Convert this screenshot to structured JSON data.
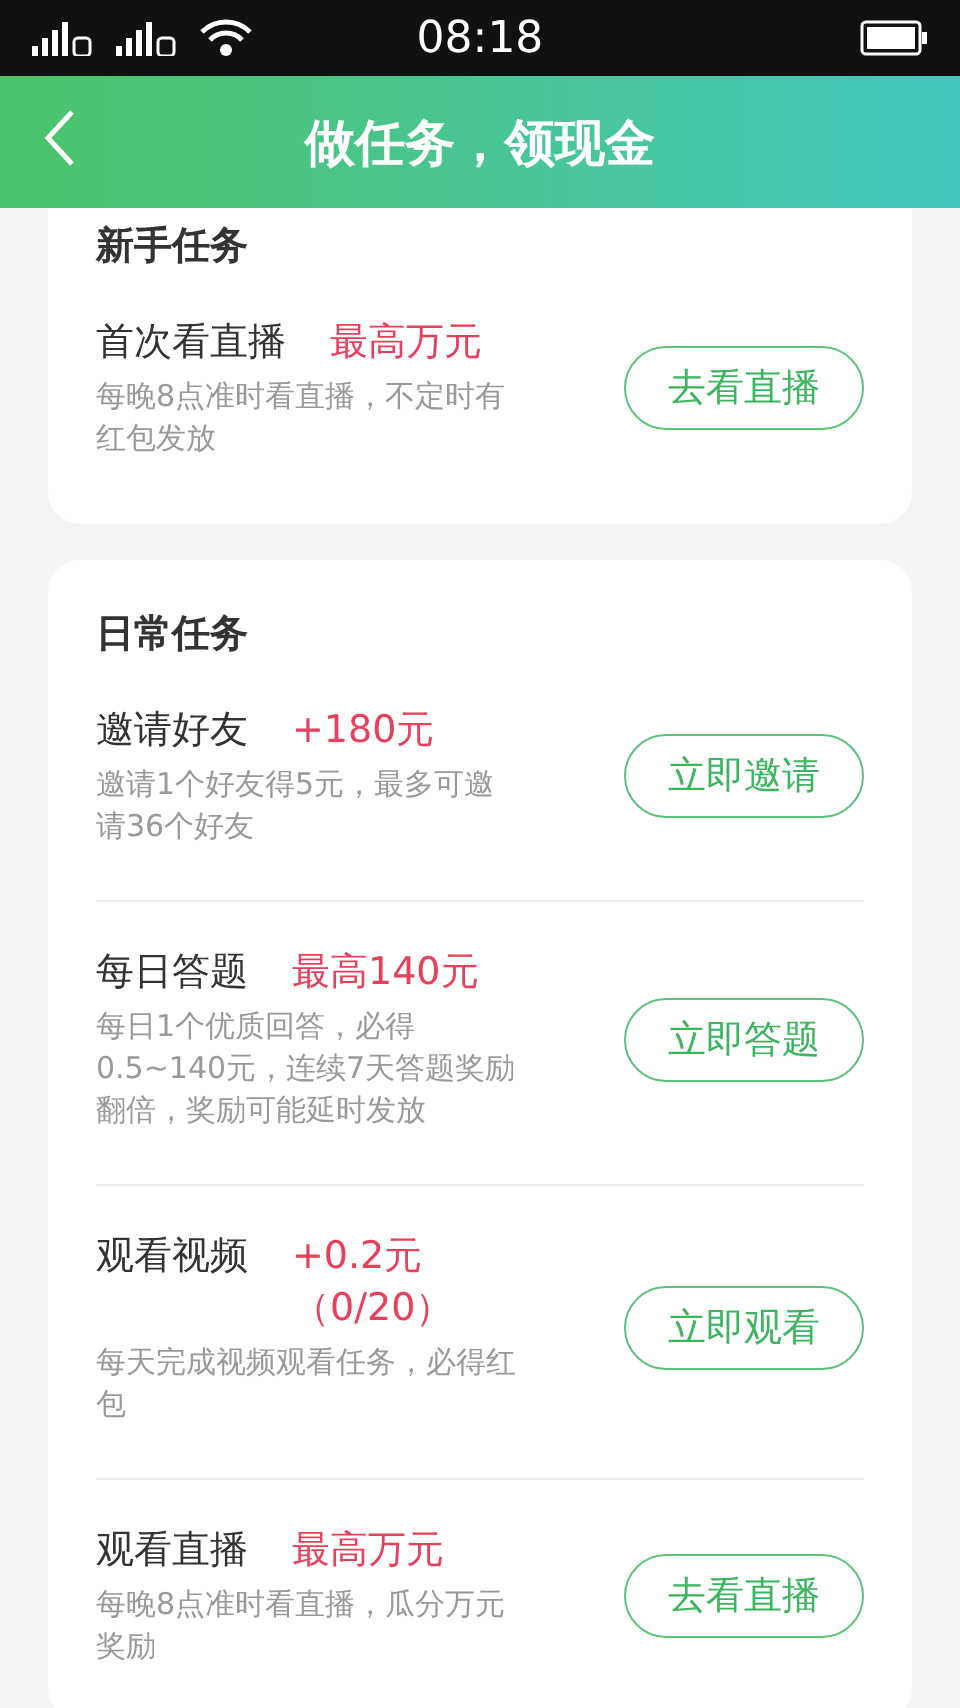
{
  "status_bar": {
    "time": "08:18"
  },
  "header": {
    "title": "做任务，领现金"
  },
  "sections": [
    {
      "title": "新手任务",
      "tasks": [
        {
          "name": "首次看直播",
          "reward": "最高万元",
          "description": "每晚8点准时看直播，不定时有红包发放",
          "button": "去看直播"
        }
      ]
    },
    {
      "title": "日常任务",
      "tasks": [
        {
          "name": "邀请好友",
          "reward": "+180元",
          "description": "邀请1个好友得5元，最多可邀请36个好友",
          "button": "立即邀请"
        },
        {
          "name": "每日答题",
          "reward": "最高140元",
          "description": "每日1个优质回答，必得0.5~140元，连续7天答题奖励翻倍，奖励可能延时发放",
          "button": "立即答题"
        },
        {
          "name": "观看视频",
          "reward": "+0.2元（0/20）",
          "description": "每天完成视频观看任务，必得红包",
          "button": "立即观看"
        },
        {
          "name": "观看直播",
          "reward": "最高万元",
          "description": "每晚8点准时看直播，瓜分万元奖励",
          "button": "去看直播"
        }
      ]
    }
  ]
}
